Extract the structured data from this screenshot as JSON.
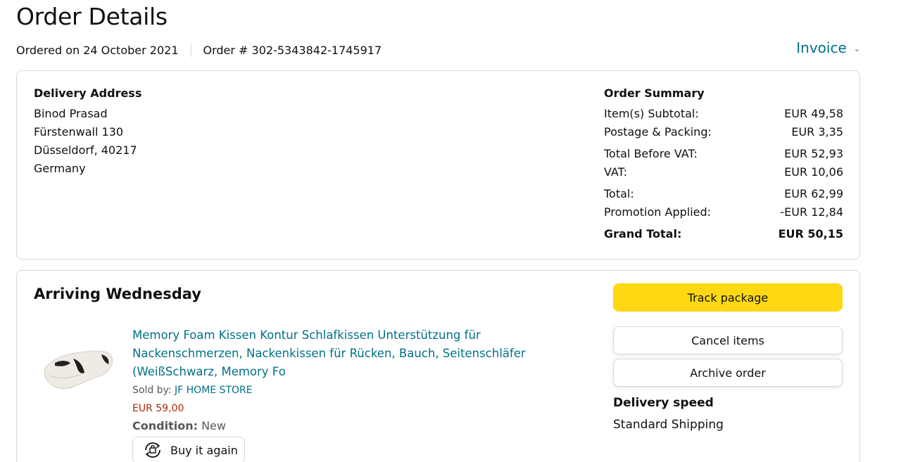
{
  "header": {
    "title": "Order Details",
    "ordered_on": "Ordered on 24 October 2021",
    "order_number": "Order # 302-5343842-1745917",
    "invoice_label": "Invoice"
  },
  "address": {
    "heading": "Delivery Address",
    "lines": [
      "Binod Prasad",
      "Fürstenwall 130",
      "Düsseldorf, 40217",
      "Germany"
    ]
  },
  "summary": {
    "heading": "Order Summary",
    "rows": [
      {
        "label": "Item(s) Subtotal:",
        "value": "EUR 49,58"
      },
      {
        "label": "Postage & Packing:",
        "value": "EUR 3,35"
      },
      {
        "label": "Total Before VAT:",
        "value": "EUR 52,93"
      },
      {
        "label": "VAT:",
        "value": "EUR 10,06"
      },
      {
        "label": "Total:",
        "value": "EUR 62,99"
      },
      {
        "label": "Promotion Applied:",
        "value": "-EUR 12,84"
      },
      {
        "label": "Grand Total:",
        "value": "EUR 50,15"
      }
    ]
  },
  "shipment": {
    "status": "Arriving Wednesday",
    "product": {
      "title": "Memory Foam Kissen Kontur Schlafkissen Unterstützung für Nackenschmerzen, Nackenkissen für Rücken, Bauch, Seitenschläfer (WeißSchwarz, Memory Fo",
      "sold_by_label": "Sold by:",
      "seller": "JF HOME STORE",
      "price": "EUR 59,00",
      "condition_label": "Condition:",
      "condition_value": "New",
      "buy_again_label": "Buy it again"
    },
    "actions": {
      "track": "Track package",
      "cancel": "Cancel items",
      "archive": "Archive order"
    },
    "delivery_speed_heading": "Delivery speed",
    "delivery_speed_value": "Standard Shipping"
  },
  "colors": {
    "link": "#007185",
    "price": "#b12704",
    "primary_button": "#ffd814",
    "border": "#d5d9d9"
  }
}
